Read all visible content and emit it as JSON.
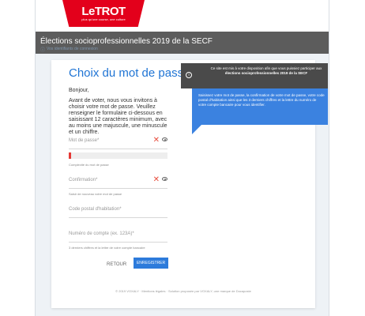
{
  "brand": {
    "name": "LeTROT",
    "tagline": "plus qu'une course, une culture"
  },
  "header": {
    "title": "Élections socioprofessionnelles 2019 de la SECF",
    "sub": "Vos identifiants de connexion"
  },
  "form": {
    "title": "Choix du mot de passe",
    "greeting": "Bonjour,",
    "intro": "Avant de voter, nous vous invitons à choisir votre mot de passe. Veuillez renseigner le formulaire ci-dessous en saisissant 12 caractères minimum, avec au moins une majuscule, une minuscule et un chiffre.",
    "password_label": "Mot de passe*",
    "strength_label": "Complexité du mot de passe",
    "strength_level": 0.02,
    "confirmation_label": "Confirmation*",
    "confirmation_hint": "Saisir de nouveau votre mot de passe",
    "postal_label": "Code postal d'habitation*",
    "account_label": "Numéro de compte (ex. 123A)*",
    "account_hint": "3 derniers chiffres et la lettre de votre compte bancaire",
    "back_label": "RETOUR",
    "save_label": "ENREGISTRER"
  },
  "info": {
    "dark_text_pre": "Ce site est mis à votre disposition afin que vous puissiez participer aux ",
    "dark_text_bold": "élections socioprofessionnelles 2019 de la SECF",
    "blue_text": "Saisissez votre mot de passe, la confirmation de votre mot de passe, votre code postal d'habitation ainsi que les 3 derniers chiffres et la lettre du numéro de votre compte bancaire pour vous identifier."
  },
  "footer": {
    "text": "© 2019 VOXALY · Mentions légales · Solution proposée par VOXALY, une marque de Docaposte"
  },
  "colors": {
    "accent": "#1f74d4",
    "brand_red": "#e3001b",
    "error": "#e74c3c"
  }
}
